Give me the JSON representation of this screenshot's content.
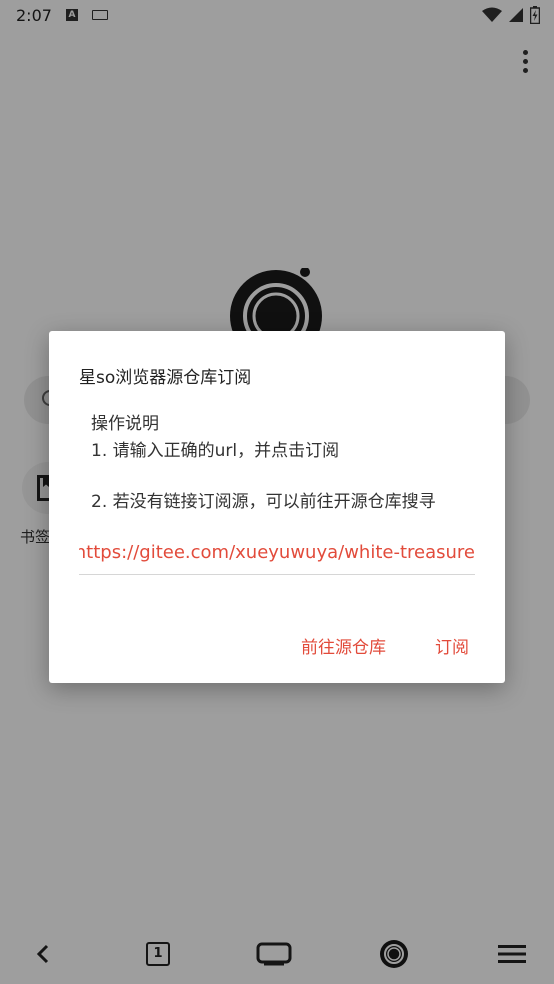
{
  "status_bar": {
    "time": "2:07",
    "a_badge": "A"
  },
  "home": {
    "bookmark_label": "书签"
  },
  "bottom_nav": {
    "tab_count": "1"
  },
  "dialog": {
    "title": "星so浏览器源仓库订阅",
    "message_heading": "操作说明",
    "message_line1": "1. 请输入正确的url，并点击订阅",
    "message_line2": "2. 若没有链接订阅源，可以前往开源仓库搜寻",
    "url_value": "https://gitee.com/xueyuwuya/white-treasure",
    "button_repo": "前往源仓库",
    "button_subscribe": "订阅"
  },
  "colors": {
    "accent": "#e24b3b",
    "scrim": "rgba(0,0,0,0.38)"
  }
}
